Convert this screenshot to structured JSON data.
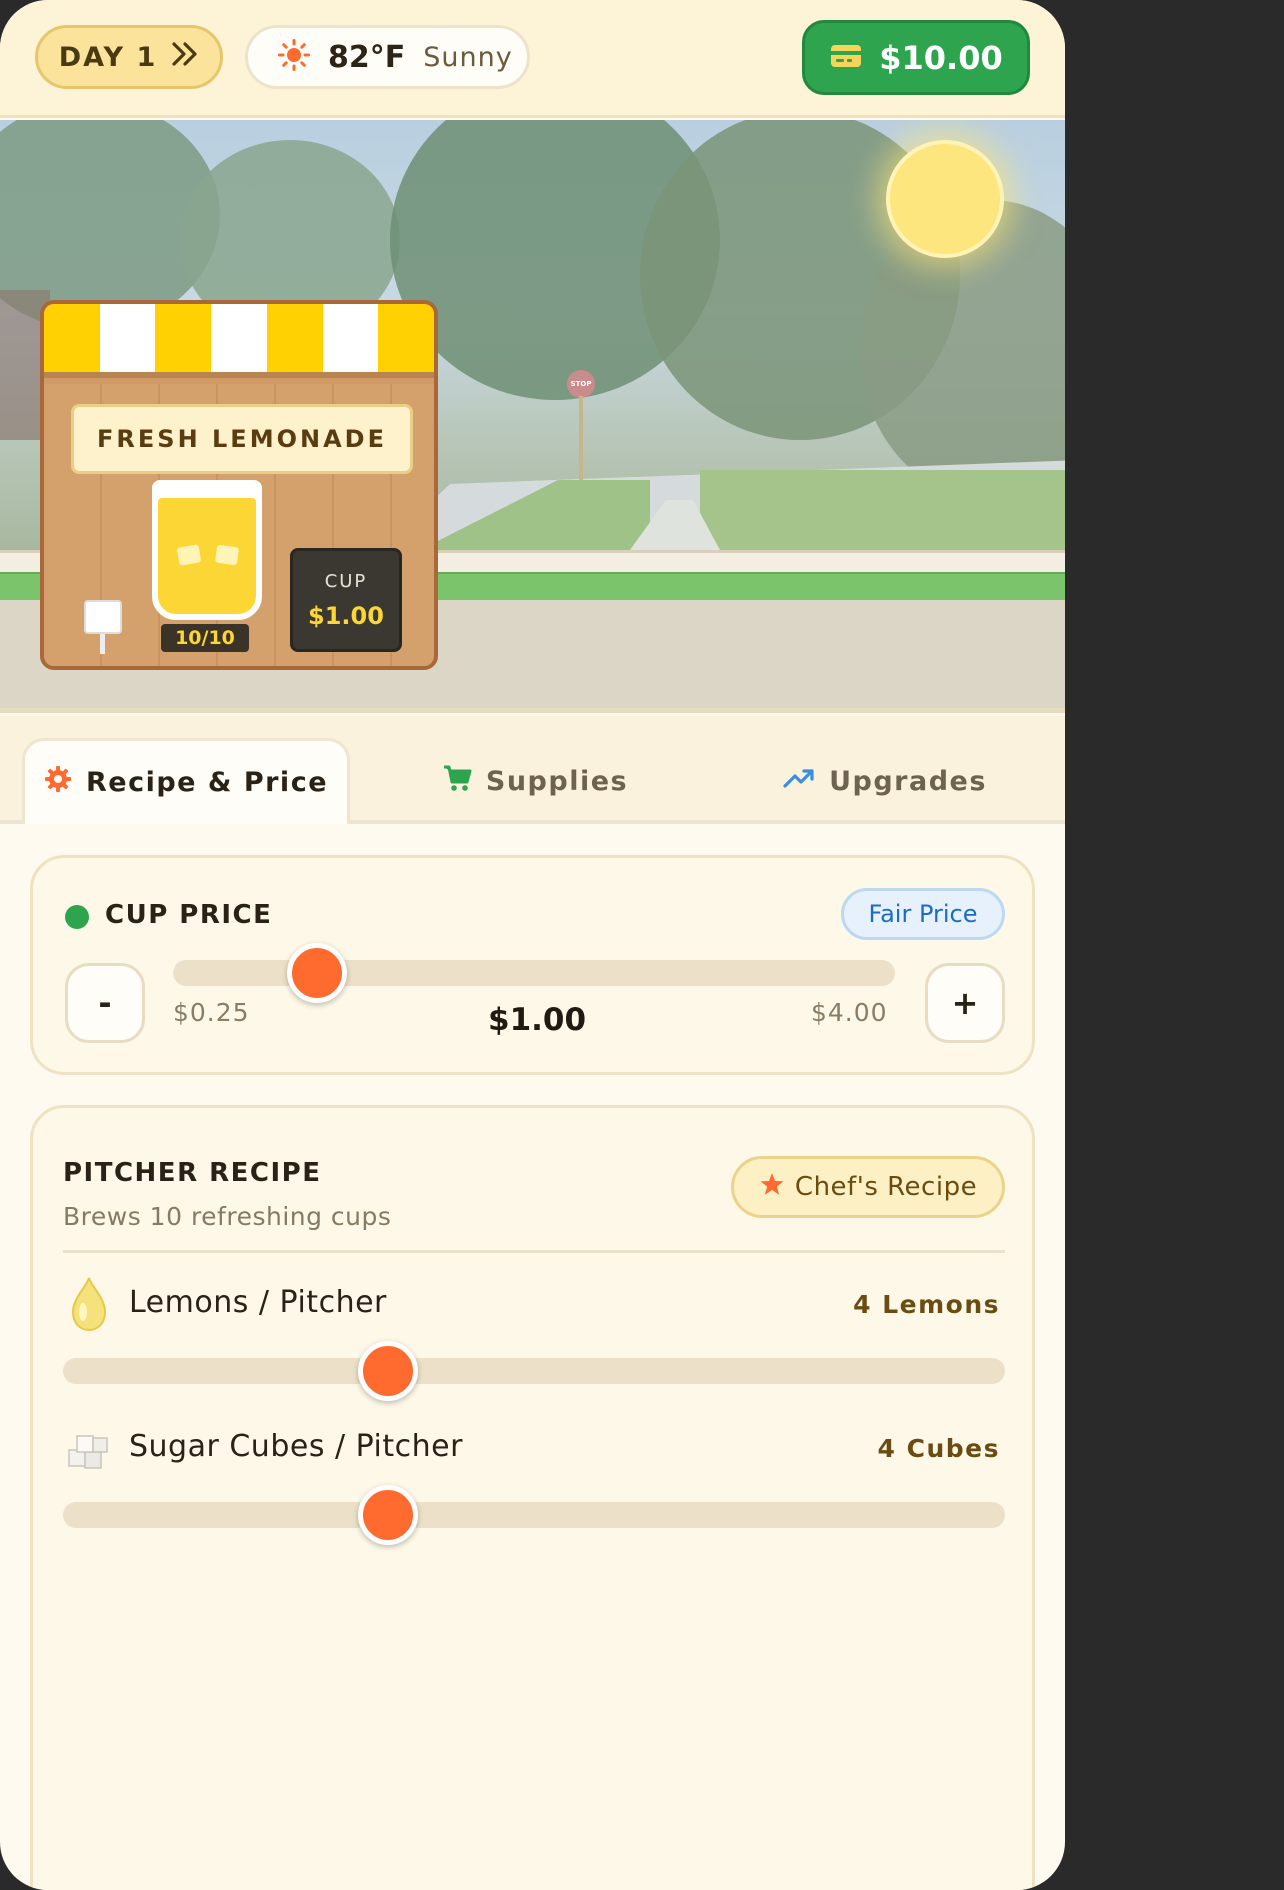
{
  "topbar": {
    "day_label": "DAY 1",
    "temperature": "82°F",
    "condition": "Sunny",
    "money": "$10.00"
  },
  "scene": {
    "stand_sign": "FRESH LEMONADE",
    "stock": "10/10",
    "board_label": "CUP",
    "board_price": "$1.00",
    "stop_sign": "STOP"
  },
  "tabs": [
    {
      "label": "Recipe & Price",
      "icon": "gear-icon",
      "active": true
    },
    {
      "label": "Supplies",
      "icon": "cart-icon",
      "active": false
    },
    {
      "label": "Upgrades",
      "icon": "trending-up-icon",
      "active": false
    }
  ],
  "price_card": {
    "title": "CUP PRICE",
    "badge": "Fair Price",
    "minus": "-",
    "plus": "+",
    "min_label": "$0.25",
    "max_label": "$4.00",
    "value_label": "$1.00",
    "min": 0.25,
    "max": 4.0,
    "value": 1.0
  },
  "recipe_card": {
    "title": "PITCHER RECIPE",
    "subtitle": "Brews 10 refreshing cups",
    "badge": "Chef's Recipe",
    "ingredients": [
      {
        "label": "Lemons / Pitcher",
        "value": "4 Lemons",
        "icon": "lemon-icon",
        "level": 0.345
      },
      {
        "label": "Sugar Cubes / Pitcher",
        "value": "4 Cubes",
        "icon": "sugar-cubes-icon",
        "level": 0.345
      }
    ]
  },
  "colors": {
    "accent": "#ff6a2f",
    "money_green": "#2ea44f",
    "lemon_yellow": "#fcd635",
    "fair_blue": "#1c6cc4"
  }
}
